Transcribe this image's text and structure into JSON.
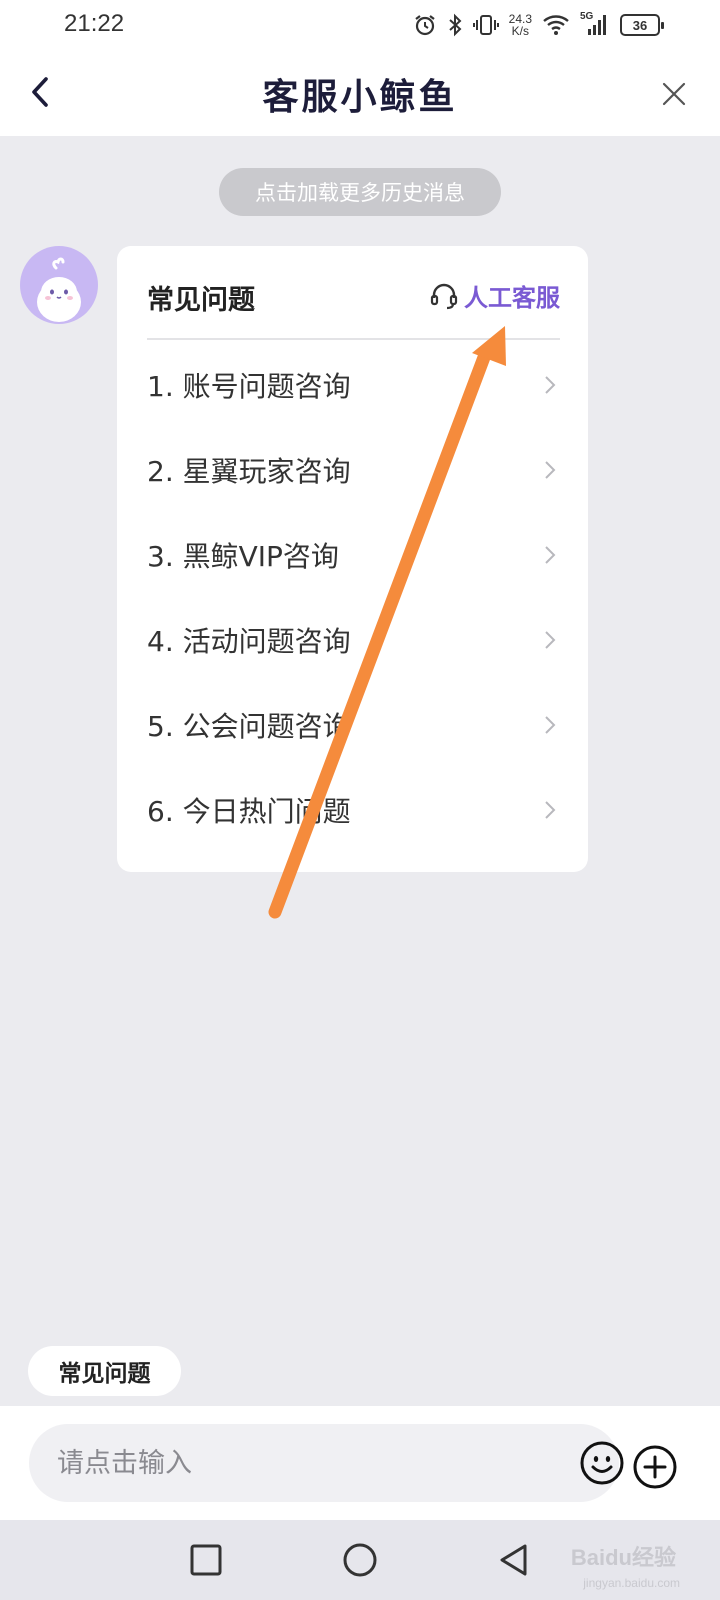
{
  "status_bar": {
    "time": "21:22",
    "net_speed_value": "24.3",
    "net_speed_unit": "K/s",
    "network": "5G",
    "battery": "36"
  },
  "header": {
    "title": "客服小鲸鱼"
  },
  "history_button": "点击加载更多历史消息",
  "faq_card": {
    "title": "常见问题",
    "human_service": "人工客服",
    "items": [
      {
        "label": "1. 账号问题咨询"
      },
      {
        "label": "2. 星翼玩家咨询"
      },
      {
        "label": "3. 黑鲸VIP咨询"
      },
      {
        "label": "4. 活动问题咨询"
      },
      {
        "label": "5. 公会问题咨询"
      },
      {
        "label": "6. 今日热门问题"
      }
    ]
  },
  "quick_chip": "常见问题",
  "input": {
    "placeholder": "请点击输入"
  },
  "colors": {
    "accent": "#7a5ad3",
    "arrow": "#f58b3c",
    "background": "#ebebef"
  },
  "watermark": {
    "logo": "Baidu经验",
    "url": "jingyan.baidu.com"
  }
}
